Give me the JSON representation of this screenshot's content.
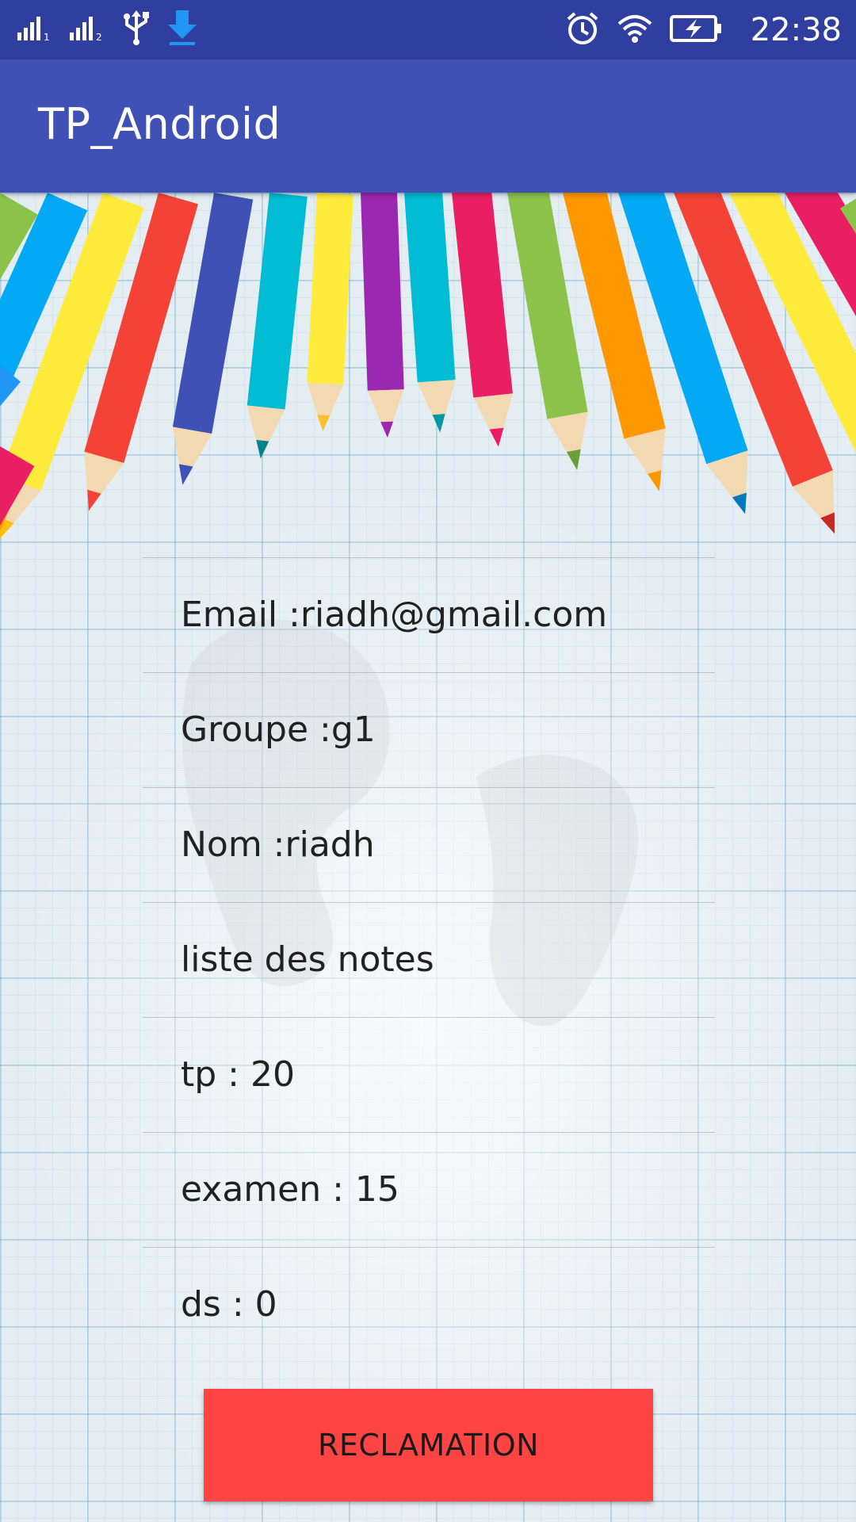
{
  "status_bar": {
    "time": "22:38",
    "icons": [
      "signal-sim1-icon",
      "signal-sim2-icon",
      "usb-icon",
      "download-icon",
      "alarm-icon",
      "wifi-icon",
      "battery-charging-icon"
    ]
  },
  "app_bar": {
    "title": "TP_Android"
  },
  "info": {
    "email": "Email :riadh@gmail.com",
    "groupe": "Groupe :g1",
    "nom": "Nom :riadh",
    "liste_notes": "liste des notes",
    "tp": "tp : 20",
    "examen": "examen : 15",
    "ds": "ds : 0"
  },
  "button": {
    "label": "RECLAMATION",
    "color": "#ff4444"
  },
  "colors": {
    "status_bar": "#303f9f",
    "app_bar": "#3f51b5"
  }
}
